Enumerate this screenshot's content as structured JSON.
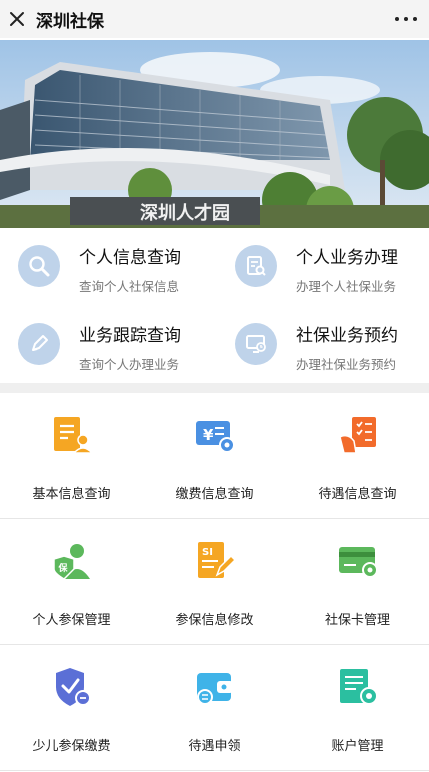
{
  "window": {
    "title": "深圳社保"
  },
  "banner": {
    "sign_text": "深圳人才园"
  },
  "quick_services": [
    {
      "title": "个人信息查询",
      "subtitle": "查询个人社保信息",
      "icon": "magnifier-icon"
    },
    {
      "title": "个人业务办理",
      "subtitle": "办理个人社保业务",
      "icon": "document-search-icon"
    },
    {
      "title": "业务跟踪查询",
      "subtitle": "查询个人办理业务",
      "icon": "pen-icon"
    },
    {
      "title": "社保业务预约",
      "subtitle": "办理社保业务预约",
      "icon": "monitor-clock-icon"
    }
  ],
  "services": [
    {
      "label": "基本信息查询",
      "icon": "user-document-icon",
      "color": "#f5a623"
    },
    {
      "label": "缴费信息查询",
      "icon": "yuan-card-gear-icon",
      "color": "#4a90e2"
    },
    {
      "label": "待遇信息查询",
      "icon": "hand-checklist-icon",
      "color": "#f26b2b"
    },
    {
      "label": "个人参保管理",
      "icon": "insured-person-icon",
      "color": "#5cb85c"
    },
    {
      "label": "参保信息修改",
      "icon": "si-document-edit-icon",
      "color": "#f5a623"
    },
    {
      "label": "社保卡管理",
      "icon": "card-gear-icon",
      "color": "#5cb85c"
    },
    {
      "label": "少儿参保缴费",
      "icon": "shield-check-icon",
      "color": "#5b6fd6"
    },
    {
      "label": "待遇申领",
      "icon": "wallet-icon",
      "color": "#3fb3e8"
    },
    {
      "label": "账户管理",
      "icon": "account-gear-icon",
      "color": "#2bbfa0"
    }
  ]
}
